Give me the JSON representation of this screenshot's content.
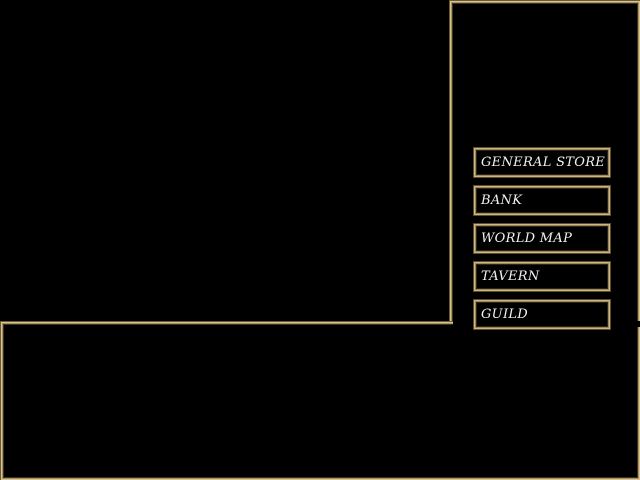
{
  "town_menu": {
    "buttons": [
      {
        "label": "GENERAL STORE"
      },
      {
        "label": "BANK"
      },
      {
        "label": "WORLD MAP"
      },
      {
        "label": "TAVERN"
      },
      {
        "label": "GUILD"
      }
    ]
  },
  "colors": {
    "background": "#000000",
    "frame_gold": "#d8c491",
    "text": "#f2f2f2"
  }
}
